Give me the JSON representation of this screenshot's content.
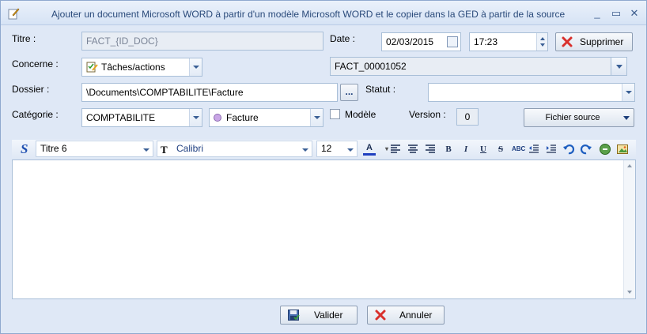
{
  "window": {
    "title": "Ajouter un document Microsoft WORD à partir d'un modèle Microsoft WORD et le copier dans la GED à partir de la source"
  },
  "form": {
    "titre_label": "Titre :",
    "titre_value": "FACT_{ID_DOC}",
    "date_label": "Date :",
    "date_value": "02/03/2015",
    "time_value": "17:23",
    "supprimer_label": "Supprimer",
    "concerne_label": "Concerne :",
    "concerne_value": "Tâches/actions",
    "reference_value": "FACT_00001052",
    "dossier_label": "Dossier :",
    "dossier_value": "\\Documents\\COMPTABILITE\\Facture",
    "browse_label": "...",
    "statut_label": "Statut :",
    "statut_value": "",
    "categorie_label": "Catégorie :",
    "categorie_value": "COMPTABILITE",
    "type_value": "Facture",
    "modele_label": "Modèle",
    "version_label": "Version :",
    "version_value": "0",
    "fichier_source_label": "Fichier source"
  },
  "toolbar": {
    "style_value": "Titre 6",
    "font_value": "Calibri",
    "size_value": "12"
  },
  "footer": {
    "valider_label": "Valider",
    "annuler_label": "Annuler"
  },
  "colors": {
    "accent": "#3a5f95",
    "delete_red": "#d9302c",
    "type_dot": "#c9a6e6"
  }
}
